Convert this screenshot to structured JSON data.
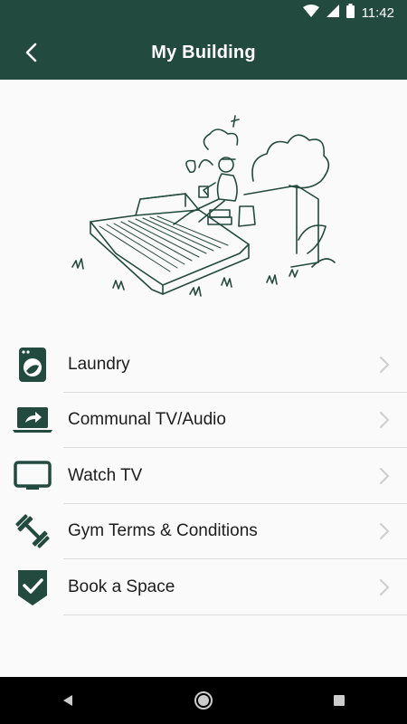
{
  "status_bar": {
    "time": "11:42"
  },
  "header": {
    "title": "My Building"
  },
  "menu": {
    "items": [
      {
        "label": "Laundry",
        "icon": "washing-machine-icon"
      },
      {
        "label": "Communal TV/Audio",
        "icon": "laptop-share-icon"
      },
      {
        "label": "Watch TV",
        "icon": "tv-icon"
      },
      {
        "label": "Gym Terms & Conditions",
        "icon": "dumbbell-icon"
      },
      {
        "label": "Book a Space",
        "icon": "checkmark-shield-icon"
      }
    ]
  },
  "colors": {
    "brand": "#234a3e",
    "divider": "#dedede",
    "chevron": "#cfcfcf"
  }
}
